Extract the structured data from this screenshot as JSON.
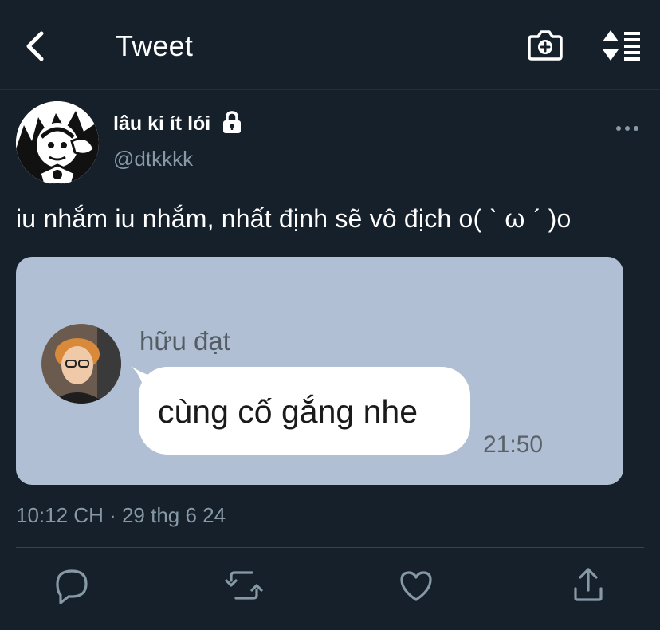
{
  "header": {
    "title": "Tweet",
    "icons": [
      "back-chevron-icon",
      "camera-plus-icon",
      "sort-icon"
    ]
  },
  "tweet": {
    "display_name": "lâu ki ít lói",
    "handle": "@dtkkkk",
    "protected_icon": "lock-icon",
    "text": "iu nhắm iu nhắm, nhất định sẽ vô địch o( ˋ ω ˊ )o",
    "timestamp": "10:12 CH · 29 thg 6 24"
  },
  "media": {
    "sender": "hữu đạt",
    "message": "cùng cố gắng nhe",
    "time": "21:50",
    "background_color": "#b0bfd3"
  },
  "actions": [
    {
      "icon": "reply-icon"
    },
    {
      "icon": "retweet-icon"
    },
    {
      "icon": "like-icon"
    },
    {
      "icon": "share-icon"
    }
  ],
  "colors": {
    "background": "#15202b",
    "secondary_text": "#8899a6",
    "divider": "#38444d"
  }
}
